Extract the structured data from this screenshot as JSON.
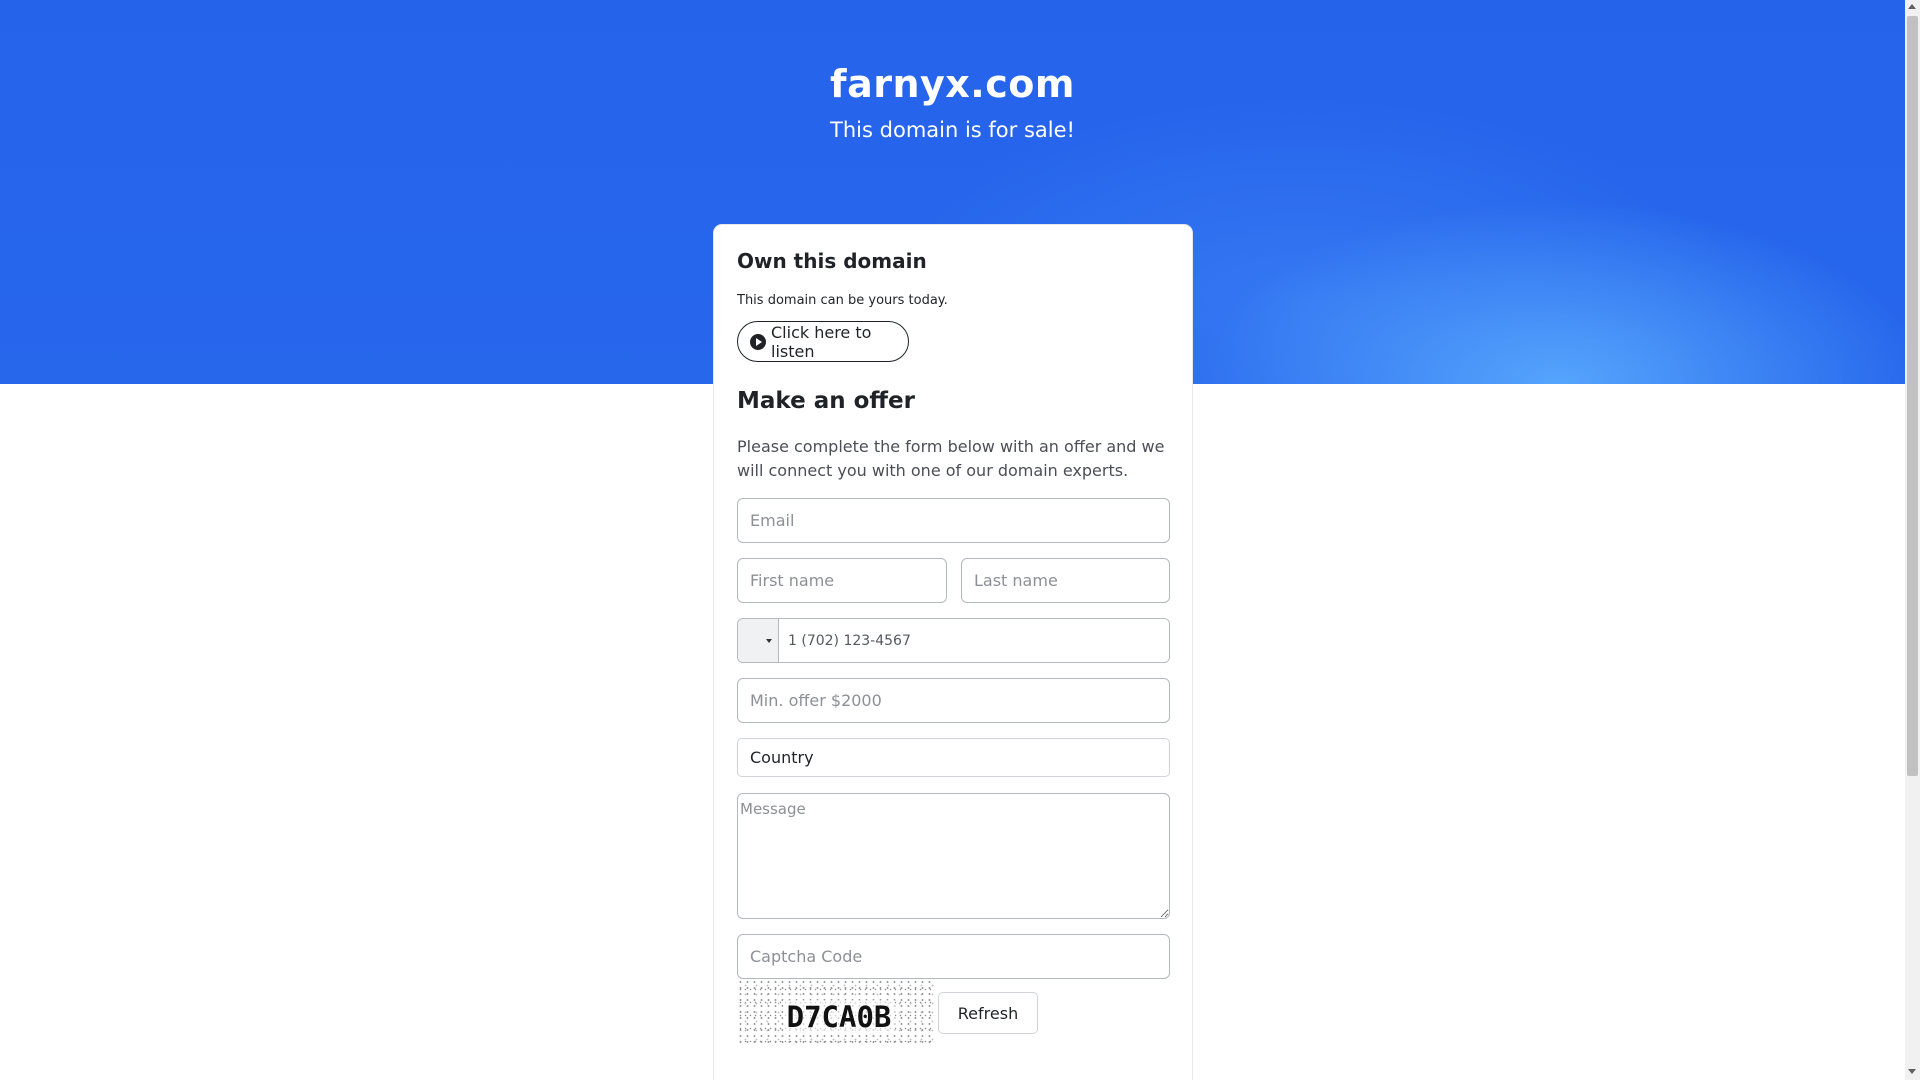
{
  "hero": {
    "title": "farnyx.com",
    "subtitle": "This domain is for sale!"
  },
  "own": {
    "title": "Own this domain",
    "text": "This domain can be yours today.",
    "listen_label": "Click here to listen"
  },
  "offer": {
    "title": "Make an offer",
    "description": "Please complete the form below with an offer and we will connect you with one of our domain experts."
  },
  "form": {
    "email_placeholder": "Email",
    "first_name_placeholder": "First name",
    "last_name_placeholder": "Last name",
    "phone_placeholder": "1 (702) 123-4567",
    "offer_placeholder": "Min. offer $2000",
    "country_value": "Country",
    "message_placeholder": "Message",
    "captcha_placeholder": "Captcha Code",
    "captcha_code": "D7CA0B",
    "refresh_label": "Refresh"
  },
  "icons": {
    "play": "play-icon",
    "dropdown": "chevron-down-icon"
  },
  "colors": {
    "hero_blue": "#2563eb",
    "hero_glow": "#5caeff",
    "text_dark": "#1f2328",
    "border": "#b4b8bf"
  }
}
